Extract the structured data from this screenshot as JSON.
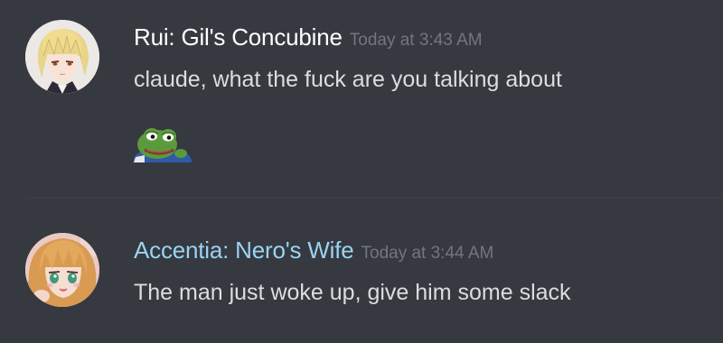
{
  "messages": [
    {
      "username": "Rui: Gil's Concubine",
      "username_color": "#ffffff",
      "timestamp": "Today at 3:43 AM",
      "content": "claude, what the fuck are you talking about",
      "attachment_icon": "pepe-frog-emoji",
      "avatar_icon": "blonde-anime-avatar"
    },
    {
      "username": "Accentia: Nero's Wife",
      "username_color": "#9bd3f3",
      "timestamp": "Today at 3:44 AM",
      "content": "The man just woke up, give him some slack",
      "avatar_icon": "anime-girl-avatar"
    }
  ],
  "colors": {
    "background": "#36393f",
    "text": "#dcddde",
    "muted": "#72767d"
  }
}
